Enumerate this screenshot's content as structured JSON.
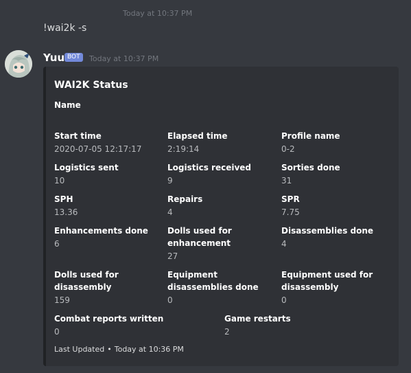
{
  "message1": {
    "timestamp": "Today at 10:37 PM",
    "text": "!wai2k -s"
  },
  "message2": {
    "username": "Yuu",
    "bot_tag": "BOT",
    "timestamp": "Today at 10:37 PM",
    "embed": {
      "title": "WAI2K Status",
      "name": "Name",
      "fields": [
        {
          "name": "Start time",
          "value": "2020-07-05 12:17:17"
        },
        {
          "name": "Elapsed time",
          "value": "2:19:14"
        },
        {
          "name": "Profile name",
          "value": "0-2"
        },
        {
          "name": "Logistics sent",
          "value": "10"
        },
        {
          "name": "Logistics received",
          "value": "9"
        },
        {
          "name": "Sorties done",
          "value": "31"
        },
        {
          "name": "SPH",
          "value": "13.36"
        },
        {
          "name": "Repairs",
          "value": "4"
        },
        {
          "name": "SPR",
          "value": "7.75"
        },
        {
          "name": "Enhancements done",
          "value": "6"
        },
        {
          "name": "Dolls used for enhancement",
          "value": "27"
        },
        {
          "name": "Disassemblies done",
          "value": "4"
        },
        {
          "name": "Dolls used for disassembly",
          "value": "159"
        },
        {
          "name": "Equipment disassemblies done",
          "value": "0"
        },
        {
          "name": "Equipment used for disassembly",
          "value": "0"
        },
        {
          "name": "Combat reports written",
          "value": "0"
        },
        {
          "name": "Game restarts",
          "value": "2"
        }
      ],
      "footer_label": "Last Updated",
      "footer_separator": "•",
      "footer_time": "Today at 10:36 PM"
    }
  },
  "colors": {
    "background": "#36393f",
    "embed_background": "#2f3136",
    "bot_tag": "#7289da"
  }
}
